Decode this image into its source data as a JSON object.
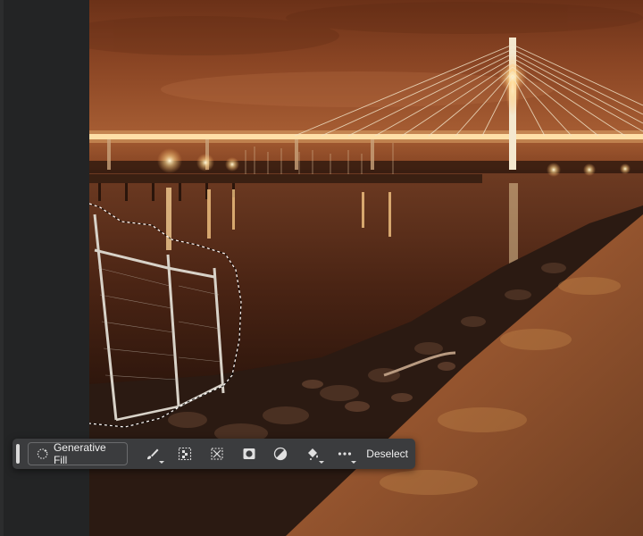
{
  "app": {
    "canvas": {
      "subject": "night photo of a cable-stayed bridge over water with marina lights, rocky shore, and a fence inside a dashed selection",
      "selection_style": "marching-ants"
    }
  },
  "taskbar": {
    "generative_fill_label": "Generative Fill",
    "tools": [
      {
        "name": "brush-icon",
        "has_menu": true
      },
      {
        "name": "select-subject-icon",
        "has_menu": false
      },
      {
        "name": "transform-selection-icon",
        "has_menu": false
      },
      {
        "name": "mask-icon",
        "has_menu": false
      },
      {
        "name": "adjustment-icon",
        "has_menu": false
      },
      {
        "name": "fill-icon",
        "has_menu": true
      },
      {
        "name": "more-icon",
        "has_menu": true
      }
    ],
    "deselect_label": "Deselect"
  },
  "colors": {
    "panel": "#232425",
    "taskbar": "#3b3c3e",
    "text": "#f0f0f0"
  }
}
